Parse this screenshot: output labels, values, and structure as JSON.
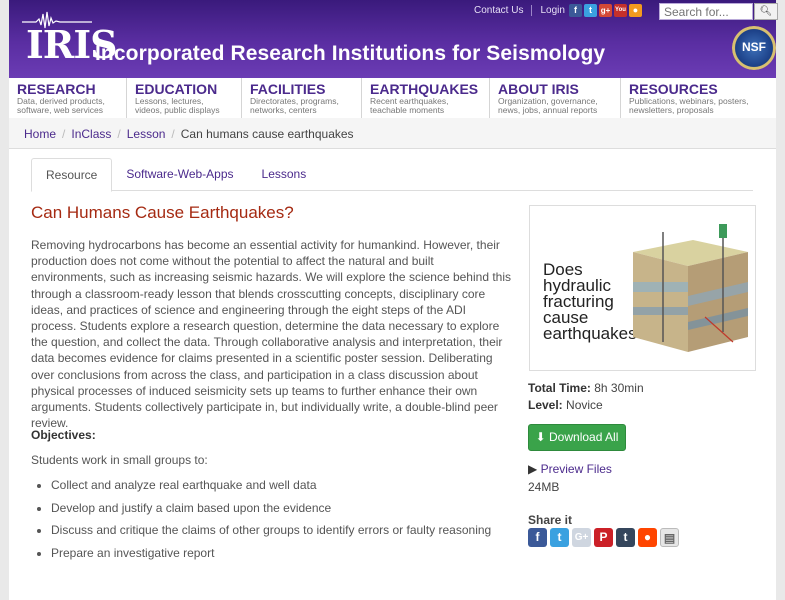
{
  "header": {
    "logo_text": "IRIS",
    "org_name": "Incorporated Research Institutions for Seismology",
    "contact_label": "Contact Us",
    "login_label": "Login",
    "search_placeholder": "Search for...",
    "nsf_text": "NSF",
    "social_icons": [
      "facebook-icon",
      "twitter-icon",
      "google-plus-icon",
      "youtube-icon",
      "rss-icon"
    ]
  },
  "nav": {
    "items": [
      {
        "title": "RESEARCH",
        "sub1": "Data, derived products,",
        "sub2": "software, web services"
      },
      {
        "title": "EDUCATION",
        "sub1": "Lessons, lectures,",
        "sub2": "videos, public displays"
      },
      {
        "title": "FACILITIES",
        "sub1": "Directorates, programs,",
        "sub2": "networks, centers"
      },
      {
        "title": "EARTHQUAKES",
        "sub1": "Recent earthquakes,",
        "sub2": "teachable moments"
      },
      {
        "title": "ABOUT IRIS",
        "sub1": "Organization, governance,",
        "sub2": "news, jobs, annual reports"
      },
      {
        "title": "RESOURCES",
        "sub1": "Publications, webinars, posters,",
        "sub2": "newsletters, proposals"
      }
    ]
  },
  "breadcrumb": {
    "home": "Home",
    "inclass": "InClass",
    "lesson": "Lesson",
    "current": "Can humans cause earthquakes",
    "separator": "/"
  },
  "tabs": [
    "Resource",
    "Software-Web-Apps",
    "Lessons"
  ],
  "content": {
    "title": "Can Humans Cause Earthquakes?",
    "description": "Removing hydrocarbons has become an essential activity for humankind. However, their production does not come without the potential to affect the natural and built environments, such as increasing seismic hazards. We will explore the science behind this through a classroom-ready lesson that blends crosscutting concepts, disciplinary core ideas, and practices of science and engineering through the eight steps of the ADI process. Students explore a research question, determine the data necessary to explore the question, and collect the data. Through collaborative analysis and interpretation, their data becomes evidence for claims presented in a scientific poster session. Deliberating over conclusions from across the class, and participation in a class discussion about physical processes of induced seismicity sets up teams to further enhance their own arguments. Students collectively participate in, but individually write, a double-blind peer review.",
    "objectives_label": "Objectives:",
    "objectives_intro": "Students work in small groups to:",
    "objectives": [
      "Collect and analyze real earthquake and well data",
      "Develop and justify a claim based upon the evidence",
      "Discuss and critique the claims of other groups to identify errors or faulty reasoning",
      "Prepare an investigative report"
    ]
  },
  "sidebar": {
    "thumb_lines": [
      "Does",
      "hydraulic",
      "fracturing",
      "cause",
      "earthquakes?"
    ],
    "total_time_label": "Total Time:",
    "total_time_value": "8h 30min",
    "level_label": "Level:",
    "level_value": "Novice",
    "download_label": "Download All",
    "preview_label": "Preview Files",
    "file_size": "24MB",
    "share_label": "Share it",
    "share_icons": [
      "facebook-icon",
      "twitter-icon",
      "google-plus-icon",
      "pinterest-icon",
      "tumblr-icon",
      "reddit-icon",
      "email-icon"
    ]
  },
  "colors": {
    "header_purple": "#5a2ea2",
    "link_purple": "#4b2a8c",
    "title_red": "#a52a12",
    "download_green": "#3aa34a"
  }
}
